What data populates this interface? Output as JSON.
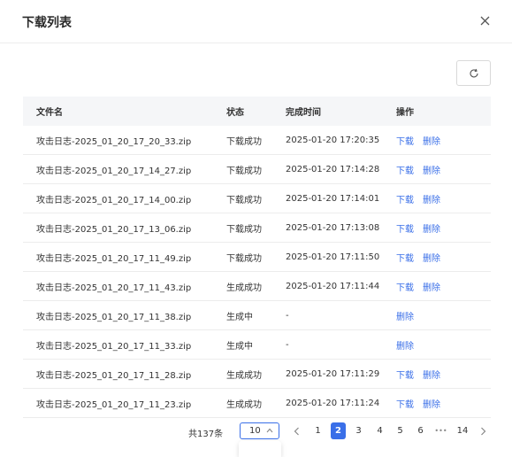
{
  "dialog": {
    "title": "下载列表"
  },
  "icons": {
    "close": "close-icon",
    "refresh": "refresh-icon"
  },
  "table": {
    "headers": {
      "filename": "文件名",
      "status": "状态",
      "completed_at": "完成时间",
      "actions": "操作"
    },
    "rows": [
      {
        "filename": "攻击日志-2025_01_20_17_20_33.zip",
        "status": "下载成功",
        "completed_at": "2025-01-20 17:20:35",
        "action1": "下载",
        "action2": "删除"
      },
      {
        "filename": "攻击日志-2025_01_20_17_14_27.zip",
        "status": "下载成功",
        "completed_at": "2025-01-20 17:14:28",
        "action1": "下载",
        "action2": "删除"
      },
      {
        "filename": "攻击日志-2025_01_20_17_14_00.zip",
        "status": "下载成功",
        "completed_at": "2025-01-20 17:14:01",
        "action1": "下载",
        "action2": "删除"
      },
      {
        "filename": "攻击日志-2025_01_20_17_13_06.zip",
        "status": "下载成功",
        "completed_at": "2025-01-20 17:13:08",
        "action1": "下载",
        "action2": "删除"
      },
      {
        "filename": "攻击日志-2025_01_20_17_11_49.zip",
        "status": "下载成功",
        "completed_at": "2025-01-20 17:11:50",
        "action1": "下载",
        "action2": "删除"
      },
      {
        "filename": "攻击日志-2025_01_20_17_11_43.zip",
        "status": "生成成功",
        "completed_at": "2025-01-20 17:11:44",
        "action1": "下载",
        "action2": "删除"
      },
      {
        "filename": "攻击日志-2025_01_20_17_11_38.zip",
        "status": "生成中",
        "completed_at": "-",
        "action1": "删除",
        "action2": ""
      },
      {
        "filename": "攻击日志-2025_01_20_17_11_33.zip",
        "status": "生成中",
        "completed_at": "-",
        "action1": "删除",
        "action2": ""
      },
      {
        "filename": "攻击日志-2025_01_20_17_11_28.zip",
        "status": "生成成功",
        "completed_at": "2025-01-20 17:11:29",
        "action1": "下载",
        "action2": "删除"
      },
      {
        "filename": "攻击日志-2025_01_20_17_11_23.zip",
        "status": "生成成功",
        "completed_at": "2025-01-20 17:11:24",
        "action1": "下载",
        "action2": "删除"
      }
    ]
  },
  "pagination": {
    "total_label": "共137条",
    "page_size": "10",
    "pages": [
      "1",
      "2",
      "3",
      "4",
      "5",
      "6"
    ],
    "current_page": "2",
    "ellipsis": "•••",
    "last_page": "14"
  },
  "colors": {
    "accent": "#3a6fe8",
    "header_bg": "#f5f6f8",
    "border": "#ececec"
  }
}
